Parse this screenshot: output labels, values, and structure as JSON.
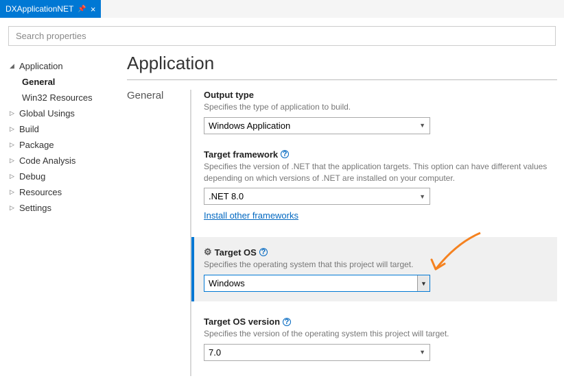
{
  "tab": {
    "title": "DXApplicationNET"
  },
  "search": {
    "placeholder": "Search properties"
  },
  "sidebar": {
    "items": [
      {
        "label": "Application",
        "expanded": true,
        "children": [
          {
            "label": "General",
            "selected": true
          },
          {
            "label": "Win32 Resources"
          }
        ]
      },
      {
        "label": "Global Usings"
      },
      {
        "label": "Build"
      },
      {
        "label": "Package"
      },
      {
        "label": "Code Analysis"
      },
      {
        "label": "Debug"
      },
      {
        "label": "Resources"
      },
      {
        "label": "Settings"
      }
    ]
  },
  "main": {
    "title": "Application",
    "section_label": "General",
    "fields": {
      "output_type": {
        "label": "Output type",
        "desc": "Specifies the type of application to build.",
        "value": "Windows Application"
      },
      "target_framework": {
        "label": "Target framework",
        "desc": "Specifies the version of .NET that the application targets. This option can have different values depending on which versions of .NET are installed on your computer.",
        "value": ".NET 8.0",
        "link": "Install other frameworks"
      },
      "target_os": {
        "label": "Target OS",
        "desc": "Specifies the operating system that this project will target.",
        "value": "Windows"
      },
      "target_os_version": {
        "label": "Target OS version",
        "desc": "Specifies the version of the operating system this project will target.",
        "value": "7.0"
      }
    }
  }
}
